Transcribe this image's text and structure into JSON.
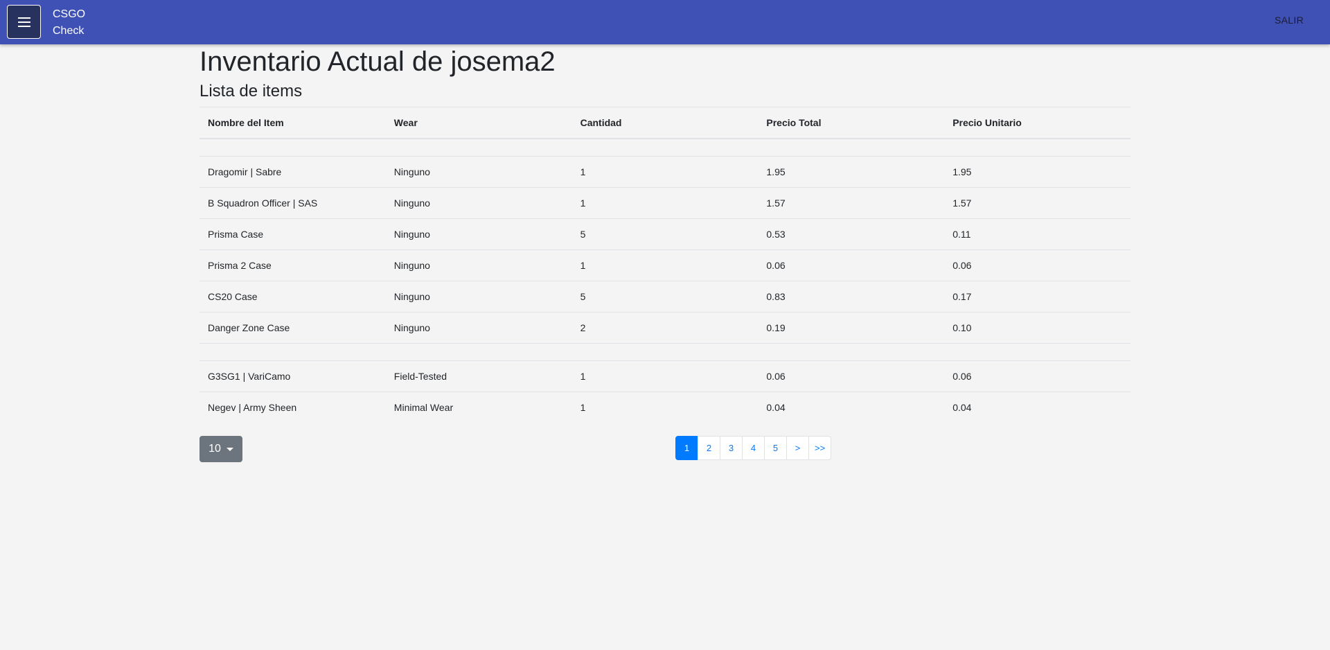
{
  "appbar": {
    "brand_line1": "CSGO",
    "brand_line2": "Check",
    "menu_icon": "hamburger-menu-icon",
    "logout_label": "SALIR",
    "color": "#3f51b5"
  },
  "page": {
    "title": "Inventario Actual de josema2",
    "list_title": "Lista de items"
  },
  "table": {
    "headers": [
      "Nombre del Item",
      "Wear",
      "Cantidad",
      "Precio Total",
      "Precio Unitario"
    ],
    "rows": [
      {
        "name": "",
        "wear": "",
        "qty": "",
        "total": "",
        "unit": ""
      },
      {
        "name": "Dragomir | Sabre",
        "wear": "Ninguno",
        "qty": "1",
        "total": "1.95",
        "unit": "1.95"
      },
      {
        "name": "B Squadron Officer | SAS",
        "wear": "Ninguno",
        "qty": "1",
        "total": "1.57",
        "unit": "1.57"
      },
      {
        "name": "Prisma Case",
        "wear": "Ninguno",
        "qty": "5",
        "total": "0.53",
        "unit": "0.11"
      },
      {
        "name": "Prisma 2 Case",
        "wear": "Ninguno",
        "qty": "1",
        "total": "0.06",
        "unit": "0.06"
      },
      {
        "name": "CS20 Case",
        "wear": "Ninguno",
        "qty": "5",
        "total": "0.83",
        "unit": "0.17"
      },
      {
        "name": "Danger Zone Case",
        "wear": "Ninguno",
        "qty": "2",
        "total": "0.19",
        "unit": "0.10"
      },
      {
        "name": "",
        "wear": "",
        "qty": "",
        "total": "",
        "unit": ""
      },
      {
        "name": "G3SG1 | VariCamo",
        "wear": "Field-Tested",
        "qty": "1",
        "total": "0.06",
        "unit": "0.06"
      },
      {
        "name": "Negev | Army Sheen",
        "wear": "Minimal Wear",
        "qty": "1",
        "total": "0.04",
        "unit": "0.04"
      }
    ]
  },
  "page_size": {
    "value": "10"
  },
  "pagination": {
    "pages": [
      "1",
      "2",
      "3",
      "4",
      "5",
      ">",
      ">>"
    ],
    "active": "1",
    "active_color": "#007bff"
  }
}
